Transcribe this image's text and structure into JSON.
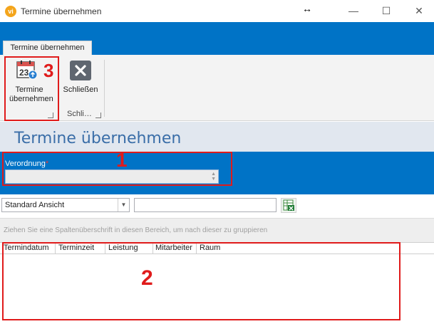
{
  "window": {
    "title": "Termine übernehmen",
    "app_icon_text": "vi",
    "minimize": "—",
    "maximize": "☐",
    "close": "✕",
    "cursor": "↔"
  },
  "ribbon": {
    "tab_label": "Termine übernehmen",
    "calendar_day": "23",
    "buttons": {
      "termine_label_line1": "Termine",
      "termine_label_line2": "übernehmen",
      "close_label": "Schließen"
    },
    "group_label": "Schli…"
  },
  "page": {
    "title": "Termine übernehmen"
  },
  "form": {
    "verordnung_label": "Verordnung",
    "required_mark": "*",
    "verordnung_value": ""
  },
  "toolbar": {
    "view_value": "Standard Ansicht",
    "search_value": ""
  },
  "grid": {
    "group_hint": "Ziehen Sie eine Spaltenüberschrift in diesen Bereich, um nach dieser zu gruppieren",
    "columns": [
      "Termindatum",
      "Terminzeit",
      "Leistung",
      "Mitarbeiter",
      "Raum"
    ]
  },
  "annotations": {
    "n1": "1",
    "n2": "2",
    "n3": "3",
    "color": "#e01b1b"
  }
}
